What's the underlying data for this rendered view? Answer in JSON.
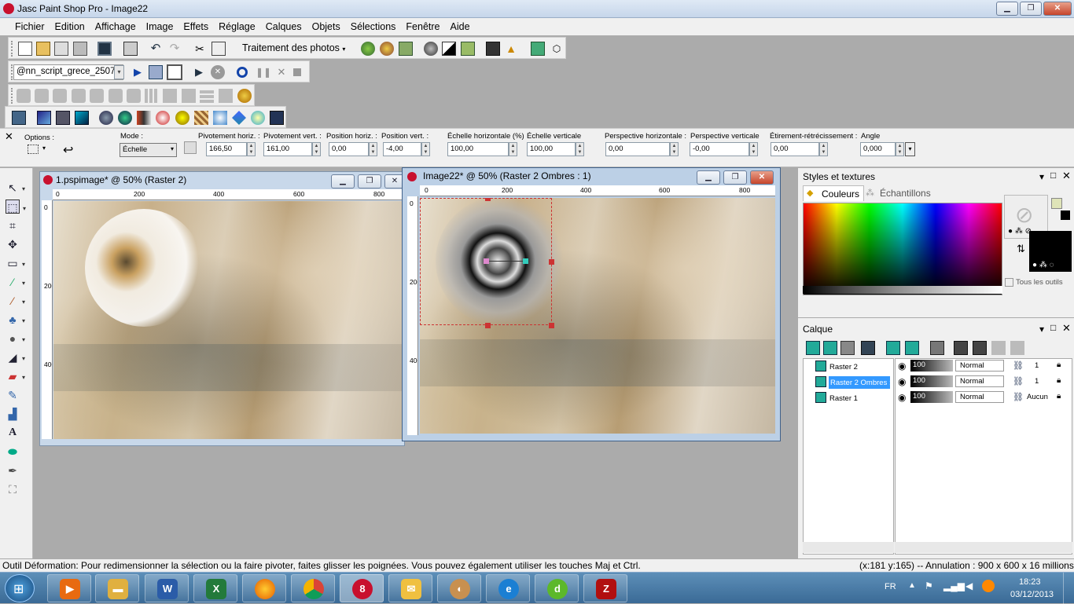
{
  "app": {
    "title": "Jasc Paint Shop Pro - Image22"
  },
  "menu": [
    "Fichier",
    "Edition",
    "Affichage",
    "Image",
    "Effets",
    "Réglage",
    "Calques",
    "Objets",
    "Sélections",
    "Fenêtre",
    "Aide"
  ],
  "toolbar": {
    "photo_label": "Traitement des photos",
    "script_name": "@nn_script_grece_2507("
  },
  "options": {
    "options_label": "Options :",
    "mode_label": "Mode :",
    "mode_value": "Échelle",
    "fields": [
      {
        "label": "Pivotement horiz. :",
        "value": "166,50"
      },
      {
        "label": "Pivotement vert. :",
        "value": "161,00"
      },
      {
        "label": "Position horiz. :",
        "value": "0,00"
      },
      {
        "label": "Position vert. :",
        "value": "-4,00"
      },
      {
        "label": "Échelle horizontale (%)",
        "value": "100,00"
      },
      {
        "label": "Échelle verticale",
        "value": "100,00"
      },
      {
        "label": "Perspective horizontale :",
        "value": "0,00"
      },
      {
        "label": "Perspective verticale",
        "value": "-0,00"
      },
      {
        "label": "Étirement-rétrécissement :",
        "value": "0,00"
      },
      {
        "label": "Angle",
        "value": "0,000"
      }
    ]
  },
  "doc1": {
    "title": "1.pspimage* @  50% (Raster 2)",
    "ruler": [
      "0",
      "200",
      "400",
      "600",
      "800"
    ],
    "vruler": [
      "0",
      "200",
      "400"
    ]
  },
  "doc2": {
    "title": "Image22* @  50% (Raster 2 Ombres : 1)",
    "ruler": [
      "0",
      "200",
      "400",
      "600",
      "800"
    ],
    "vruler": [
      "0",
      "200",
      "400"
    ]
  },
  "styles": {
    "title": "Styles et textures",
    "tab1": "Couleurs",
    "tab2": "Échantillons",
    "all_tools": "Tous les outils"
  },
  "layers": {
    "title": "Calque",
    "rows": [
      {
        "name": "Raster 2",
        "opacity": "100",
        "blend": "Normal",
        "group": "1"
      },
      {
        "name": "Raster 2 Ombres :",
        "opacity": "100",
        "blend": "Normal",
        "group": "1"
      },
      {
        "name": "Raster 1",
        "opacity": "100",
        "blend": "Normal",
        "group": "Aucun"
      }
    ]
  },
  "status": {
    "left": "Outil Déformation: Pour redimensionner la sélection ou la faire pivoter, faites glisser les poignées. Vous pouvez également utiliser les touches Maj et Ctrl.",
    "right": "(x:181 y:165) -- Annulation :  900 x 600 x 16 millions"
  },
  "taskbar": {
    "lang": "FR",
    "time": "18:23",
    "date": "03/12/2013",
    "psp_label": "8"
  },
  "colors": {
    "accent": "#3a6a96",
    "selection": "#3399ff"
  }
}
